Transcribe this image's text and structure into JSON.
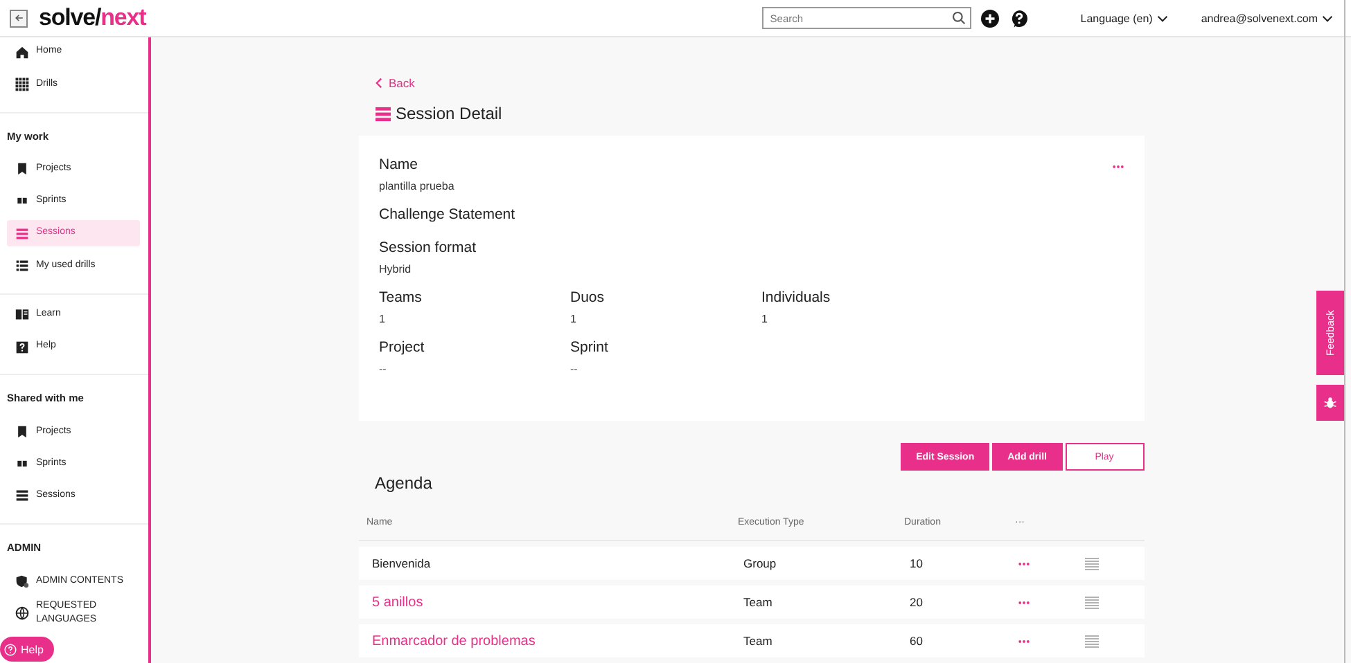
{
  "topbar": {
    "logo_main": "solve/",
    "logo_accent": "next",
    "search": {
      "placeholder": "Search"
    },
    "language": "Language (en)",
    "user": "andrea@solvenext.com"
  },
  "sidebar": {
    "sections": [
      {
        "items": [
          {
            "kind": "home",
            "label": "Home",
            "selected": false
          },
          {
            "kind": "grid",
            "label": "Drills",
            "selected": false
          }
        ]
      },
      {
        "heading": "My work",
        "items": [
          {
            "kind": "bookmark",
            "label": "Projects",
            "selected": false
          },
          {
            "kind": "sprint",
            "label": "Sprints",
            "selected": false
          },
          {
            "kind": "sessions",
            "label": "Sessions",
            "selected": true
          },
          {
            "kind": "list",
            "label": "My used drills",
            "selected": false
          }
        ]
      },
      {
        "items": [
          {
            "kind": "book",
            "label": "Learn",
            "selected": false
          },
          {
            "kind": "help",
            "label": "Help",
            "selected": false
          }
        ]
      },
      {
        "heading": "Shared with me",
        "items": [
          {
            "kind": "bookmark",
            "label": "Projects",
            "selected": false
          },
          {
            "kind": "sprint",
            "label": "Sprints",
            "selected": false
          },
          {
            "kind": "sessions",
            "label": "Sessions",
            "selected": false
          }
        ]
      },
      {
        "heading": "ADMIN",
        "items": [
          {
            "kind": "shield",
            "label": "ADMIN CONTENTS",
            "selected": false
          },
          {
            "kind": "globe",
            "label": "REQUESTED LANGUAGES",
            "selected": false
          }
        ]
      }
    ]
  },
  "back": "Back",
  "title": "Session Detail",
  "detail": {
    "fields": [
      {
        "label": "Name",
        "value": "plantilla prueba"
      },
      {
        "label": "Challenge Statement"
      },
      {
        "label": "Session format",
        "value": "Hybrid"
      }
    ],
    "counts": [
      {
        "label": "Teams",
        "value": "1"
      },
      {
        "label": "Duos",
        "value": "1"
      },
      {
        "label": "Individuals",
        "value": "1"
      }
    ],
    "links": [
      {
        "label": "Project",
        "value": "--"
      },
      {
        "label": "Sprint",
        "value": "--"
      }
    ]
  },
  "actions": [
    {
      "kind": "primary",
      "label": "Edit Session"
    },
    {
      "kind": "primary",
      "label": "Add drill"
    },
    {
      "kind": "outline",
      "label": "Play"
    }
  ],
  "agenda": {
    "title": "Agenda",
    "columns": [
      "Name",
      "Execution Type",
      "Duration",
      "···"
    ],
    "rows": [
      {
        "kind": "plain",
        "name": "Bienvenida",
        "type": "Group",
        "duration": "10"
      },
      {
        "kind": "link",
        "name": "5 anillos",
        "type": "Team",
        "duration": "20"
      },
      {
        "kind": "link",
        "name": "Enmarcador de problemas",
        "type": "Team",
        "duration": "60"
      }
    ]
  },
  "feedback": "Feedback",
  "help_button": "Help"
}
